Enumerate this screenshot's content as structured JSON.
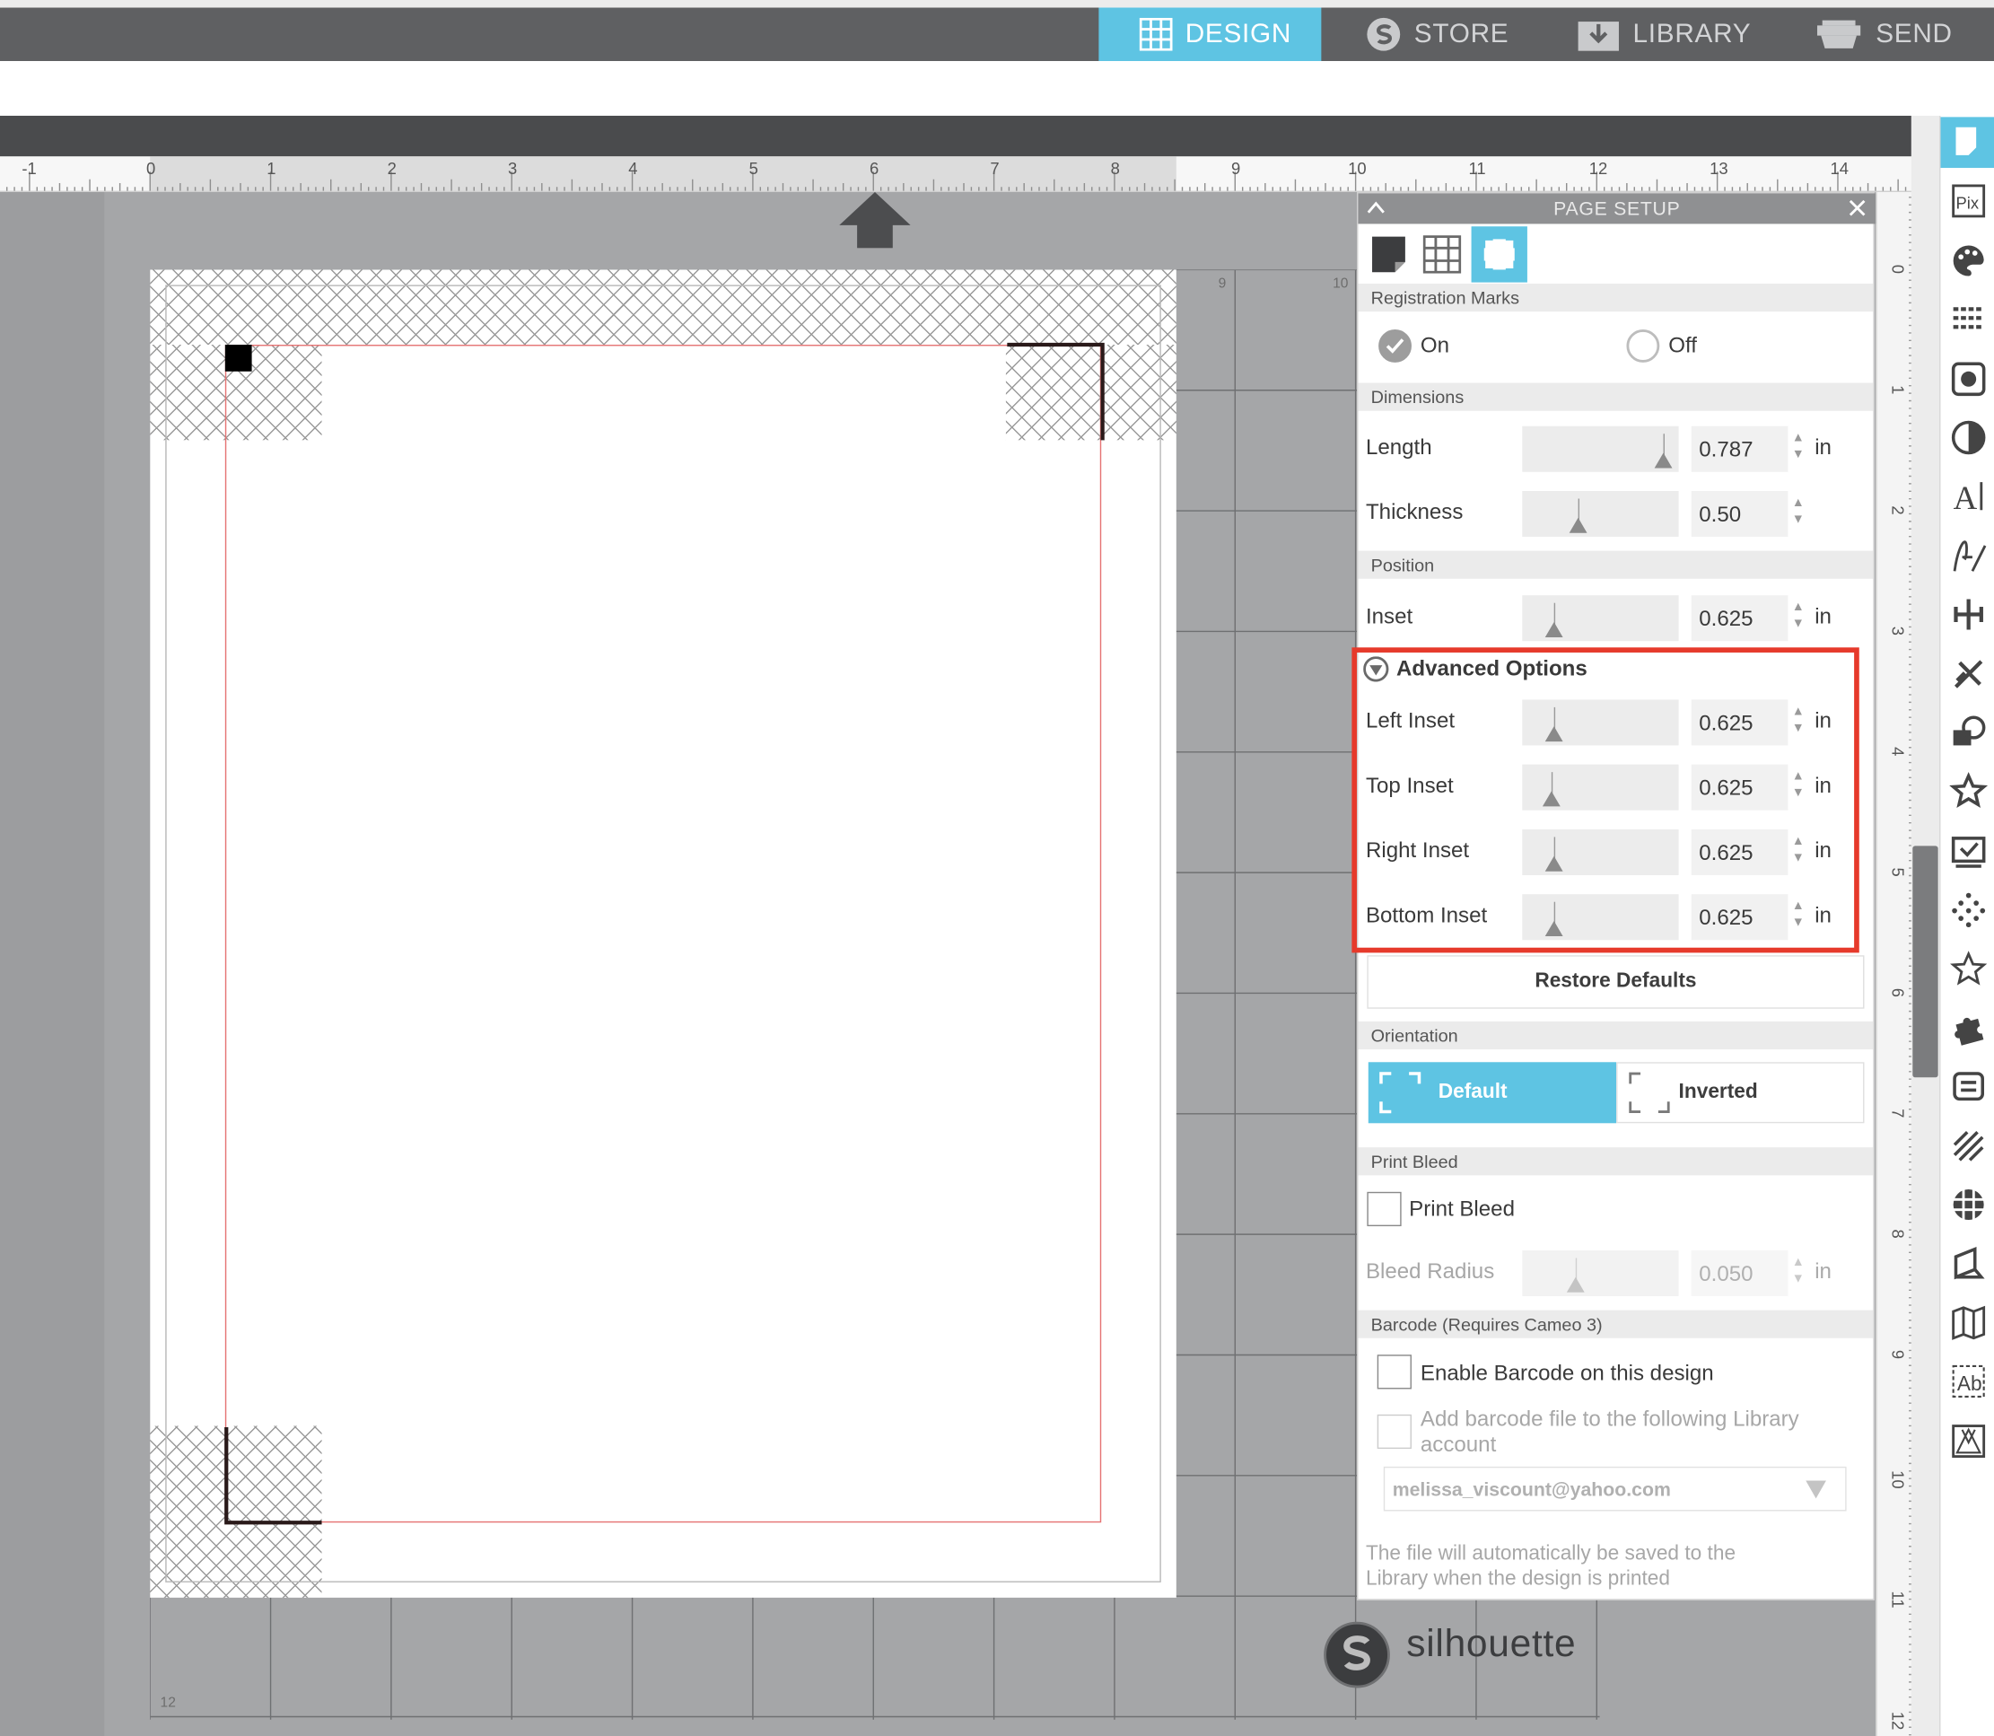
{
  "topnav": {
    "tabs": [
      {
        "label": "DESIGN",
        "icon": "grid-icon",
        "active": true
      },
      {
        "label": "STORE",
        "icon": "store-s-icon",
        "active": false
      },
      {
        "label": "LIBRARY",
        "icon": "library-download-icon",
        "active": false
      },
      {
        "label": "SEND",
        "icon": "cutter-machine-icon",
        "active": false
      }
    ]
  },
  "ruler": {
    "h_labels": [
      "-1",
      "0",
      "1",
      "2",
      "3",
      "4",
      "5",
      "6",
      "7",
      "8",
      "9",
      "10",
      "11",
      "12",
      "13",
      "14"
    ],
    "v_labels": [
      "0",
      "1",
      "2",
      "3",
      "4",
      "5",
      "6",
      "7",
      "8",
      "9",
      "10",
      "11",
      "12"
    ],
    "mat_labels": {
      "col9": "9",
      "col10": "10",
      "row12": "12"
    }
  },
  "panel": {
    "title": "PAGE SETUP",
    "collapse_icon": "chevron-up-icon",
    "close_icon": "close-icon",
    "tabs": [
      {
        "icon": "page-icon",
        "active": false
      },
      {
        "icon": "grid-icon",
        "active": false
      },
      {
        "icon": "registration-marks-icon",
        "active": true
      }
    ],
    "registration_marks": {
      "header": "Registration Marks",
      "on_label": "On",
      "off_label": "Off",
      "selected": "On"
    },
    "dimensions": {
      "header": "Dimensions",
      "length": {
        "label": "Length",
        "value": "0.787",
        "unit": "in",
        "slider": 0.95
      },
      "thickness": {
        "label": "Thickness",
        "value": "0.50",
        "unit": "",
        "slider": 0.3
      }
    },
    "position": {
      "header": "Position",
      "inset": {
        "label": "Inset",
        "value": "0.625",
        "unit": "in",
        "slider": 0.12
      }
    },
    "advanced": {
      "header": "Advanced Options",
      "rows": [
        {
          "label": "Left Inset",
          "value": "0.625",
          "unit": "in",
          "slider": 0.12
        },
        {
          "label": "Top Inset",
          "value": "0.625",
          "unit": "in",
          "slider": 0.1
        },
        {
          "label": "Right Inset",
          "value": "0.625",
          "unit": "in",
          "slider": 0.12
        },
        {
          "label": "Bottom Inset",
          "value": "0.625",
          "unit": "in",
          "slider": 0.12
        }
      ]
    },
    "restore_label": "Restore Defaults",
    "orientation": {
      "header": "Orientation",
      "default_label": "Default",
      "inverted_label": "Inverted",
      "selected": "Default"
    },
    "print_bleed": {
      "header": "Print Bleed",
      "checkbox_label": "Print Bleed",
      "checked": false,
      "radius_label": "Bleed Radius",
      "radius_value": "0.050",
      "radius_unit": "in",
      "slider": 0.28
    },
    "barcode": {
      "header": "Barcode (Requires Cameo 3)",
      "enable_label": "Enable Barcode on this design",
      "add_label_line1": "Add barcode file to the following Library",
      "add_label_line2": "account",
      "account": "melissa_viscount@yahoo.com",
      "note_line1": "The file will automatically be saved to the",
      "note_line2": "Library when the design is printed"
    }
  },
  "brand": {
    "name": "silhouette"
  },
  "colors": {
    "accent": "#5ec4e3",
    "highlight": "#e63a2b",
    "cut_line": "#e57373"
  },
  "toolbar": [
    "page-setup-icon",
    "pixscan-icon",
    "fill-palette-icon",
    "line-style-icon",
    "image-trace-icon",
    "contrast-icon",
    "text-style-icon",
    "sketch-pen-icon",
    "align-icon",
    "replicate-icon",
    "transform-icon",
    "star-favorite-icon",
    "design-store-icon",
    "points-icon",
    "shape-star-icon",
    "puzzle-offset-icon",
    "layers-icon",
    "hatch-fill-icon",
    "rhinestone-icon",
    "page-fold-icon",
    "map-icon",
    "text-box-icon",
    "pattern-triangles-icon"
  ]
}
